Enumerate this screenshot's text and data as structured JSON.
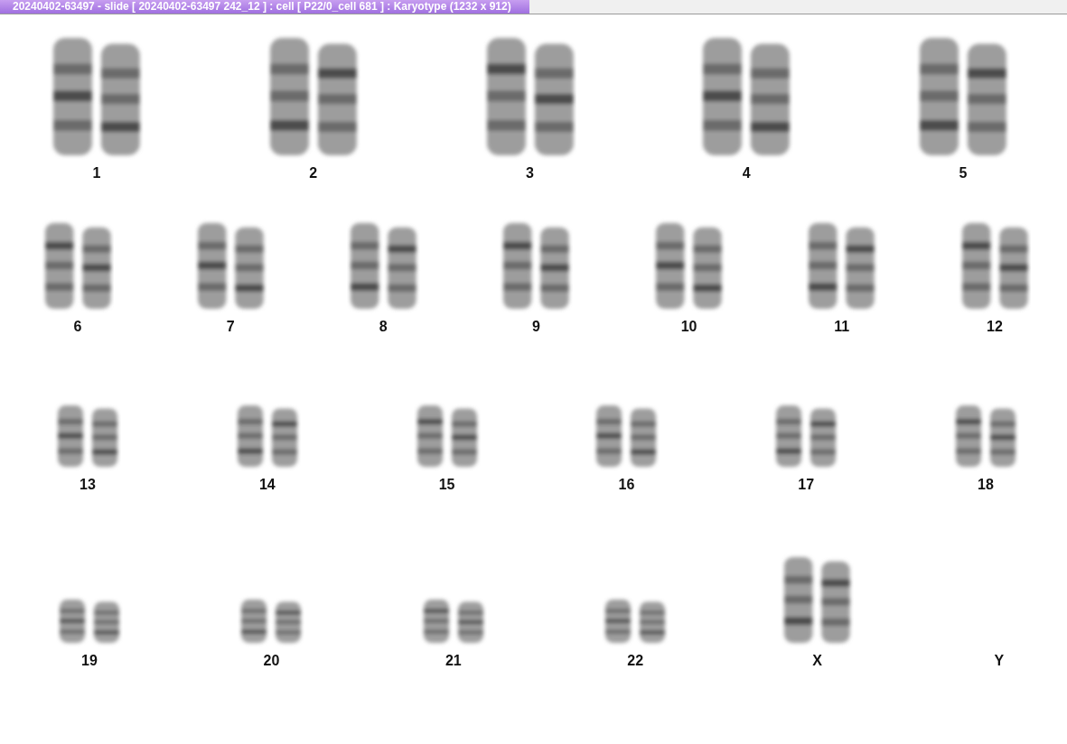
{
  "window": {
    "title": "20240402-63497 - slide [ 20240402-63497 242_12 ] : cell [ P22/0_cell 681 ] : Karyotype  (1232 x 912)"
  },
  "rows": [
    {
      "pairs": [
        {
          "label": "1",
          "kind": "pair"
        },
        {
          "label": "2",
          "kind": "pair"
        },
        {
          "label": "3",
          "kind": "pair"
        },
        {
          "label": "4",
          "kind": "pair"
        },
        {
          "label": "5",
          "kind": "pair"
        }
      ]
    },
    {
      "pairs": [
        {
          "label": "6",
          "kind": "pair"
        },
        {
          "label": "7",
          "kind": "pair"
        },
        {
          "label": "8",
          "kind": "pair"
        },
        {
          "label": "9",
          "kind": "pair"
        },
        {
          "label": "10",
          "kind": "pair"
        },
        {
          "label": "11",
          "kind": "pair"
        },
        {
          "label": "12",
          "kind": "pair"
        }
      ]
    },
    {
      "pairs": [
        {
          "label": "13",
          "kind": "pair"
        },
        {
          "label": "14",
          "kind": "pair"
        },
        {
          "label": "15",
          "kind": "pair"
        },
        {
          "label": "16",
          "kind": "pair"
        },
        {
          "label": "17",
          "kind": "pair"
        },
        {
          "label": "18",
          "kind": "pair"
        }
      ]
    },
    {
      "pairs": [
        {
          "label": "19",
          "kind": "pair"
        },
        {
          "label": "20",
          "kind": "pair"
        },
        {
          "label": "21",
          "kind": "pair"
        },
        {
          "label": "22",
          "kind": "pair"
        },
        {
          "label": "X",
          "kind": "large-pair"
        },
        {
          "label": "Y",
          "kind": "empty"
        }
      ]
    }
  ]
}
